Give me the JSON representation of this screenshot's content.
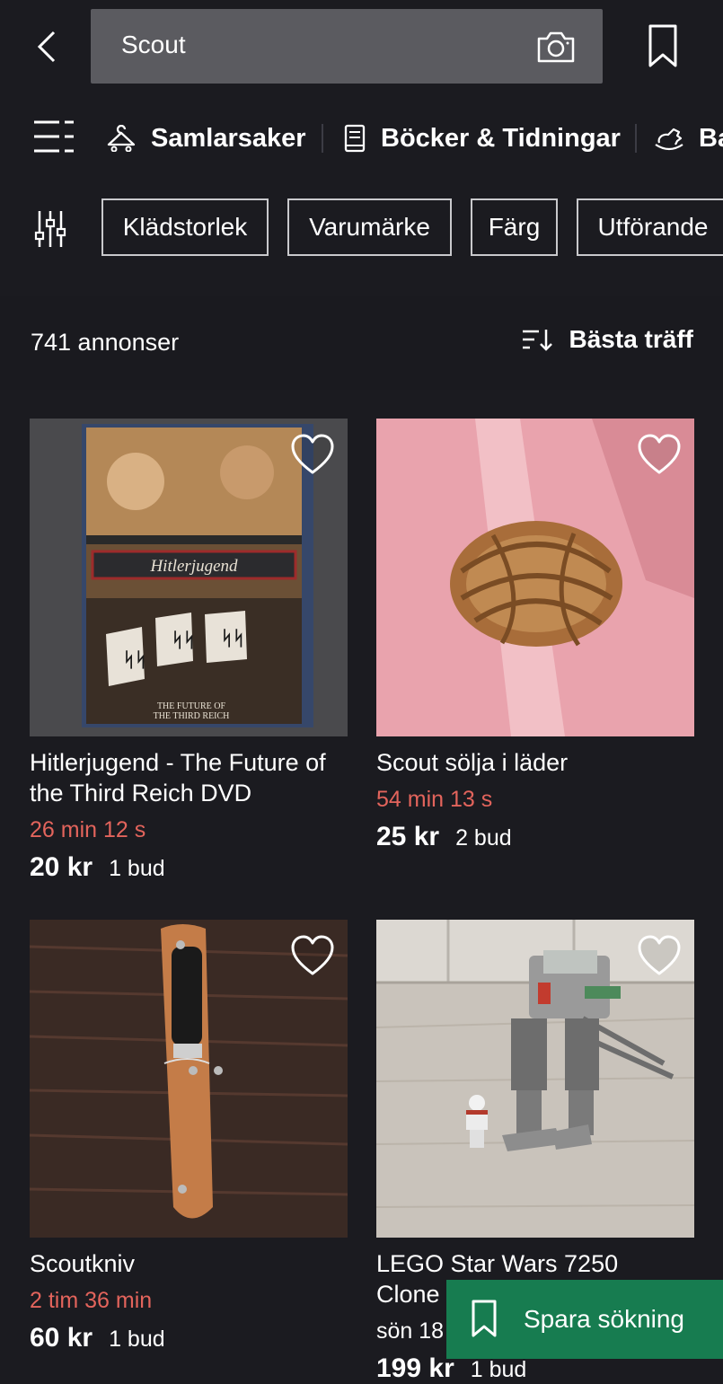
{
  "search": {
    "query": "Scout"
  },
  "categories": [
    {
      "label": "Samlarsaker",
      "icon": "hanger-icon"
    },
    {
      "label": "Böcker & Tidningar",
      "icon": "book-icon"
    },
    {
      "label": "Ba",
      "icon": "rocking-horse-icon"
    }
  ],
  "filters": [
    "Klädstorlek",
    "Varumärke",
    "Färg",
    "Utförande"
  ],
  "results": {
    "count_label": "741 annonser",
    "sort_label": "Bästa träff"
  },
  "listings": [
    {
      "title": "Hitlerjugend - The Future of the Third Reich DVD",
      "time_left": "26 min 12 s",
      "price": "20 kr",
      "bids": "1 bud",
      "image_text": {
        "banner": "Hitlerjugend",
        "caption_line1": "THE FUTURE OF",
        "caption_line2": "THE THIRD REICH"
      }
    },
    {
      "title": "Scout sölja i läder",
      "time_left": "54 min 13 s",
      "price": "25 kr",
      "bids": "2 bud"
    },
    {
      "title": "Scoutkniv",
      "time_left": "2 tim 36 min",
      "price": "60 kr",
      "bids": "1 bud"
    },
    {
      "title": "LEGO Star Wars 7250 Clone",
      "date": "sön 18",
      "price": "199 kr",
      "bids": "1 bud"
    }
  ],
  "save_search": {
    "label": "Spara sökning"
  },
  "colors": {
    "background": "#1b1b20",
    "search_box": "#5b5b60",
    "timer": "#e3645c",
    "save_button": "#177c50"
  }
}
